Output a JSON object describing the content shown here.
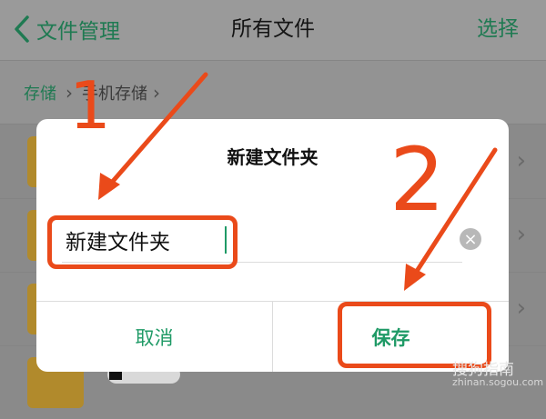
{
  "header": {
    "back_label": "文件管理",
    "title": "所有文件",
    "select_label": "选择"
  },
  "breadcrumb": {
    "storage": "存储",
    "phone_storage": "手机存储"
  },
  "dialog": {
    "title": "新建文件夹",
    "input_value": "新建文件夹",
    "cancel_label": "取消",
    "save_label": "保存"
  },
  "annotations": {
    "step1": "1",
    "step2": "2",
    "color": "#ea4a1a"
  },
  "watermark": {
    "brand": "搜狗指南",
    "url": "zhinan.sogou.com"
  },
  "colors": {
    "accent_green": "#1f9a66"
  }
}
